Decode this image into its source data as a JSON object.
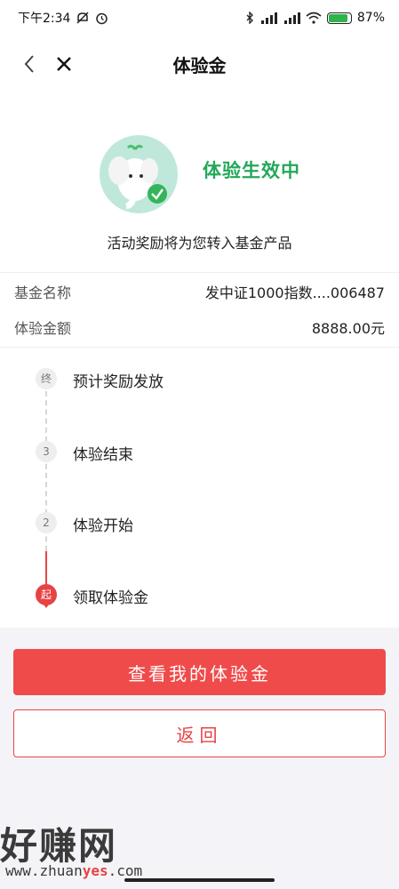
{
  "status_bar": {
    "time": "下午2:34",
    "icons_left": [
      "silent-icon",
      "alarm-icon"
    ],
    "icons_right": [
      "bluetooth-icon",
      "signal-hd-icon",
      "signal-hd-icon",
      "wifi-icon",
      "battery-icon"
    ],
    "battery_level": 0.87,
    "battery_text": "87%"
  },
  "header": {
    "title": "体验金"
  },
  "status": {
    "title": "体验生效中",
    "description": "活动奖励将为您转入基金产品",
    "accent_color": "#23a85a"
  },
  "info": [
    {
      "label": "基金名称",
      "value": "发中证1000指数....006487"
    },
    {
      "label": "体验金额",
      "value": "8888.00元"
    }
  ],
  "timeline": [
    {
      "marker": "终",
      "label": "预计奖励发放",
      "active": false
    },
    {
      "marker": "3",
      "label": "体验结束",
      "active": false
    },
    {
      "marker": "2",
      "label": "体验开始",
      "active": false
    },
    {
      "marker": "起",
      "label": "领取体验金",
      "active": true
    }
  ],
  "buttons": {
    "primary": "查看我的体验金",
    "secondary": "返回",
    "primary_color": "#f04b4b"
  },
  "watermark": {
    "brand": "好赚网",
    "url_prefix": "www.zhuan",
    "url_accent": "yes",
    "url_suffix": ".com"
  }
}
